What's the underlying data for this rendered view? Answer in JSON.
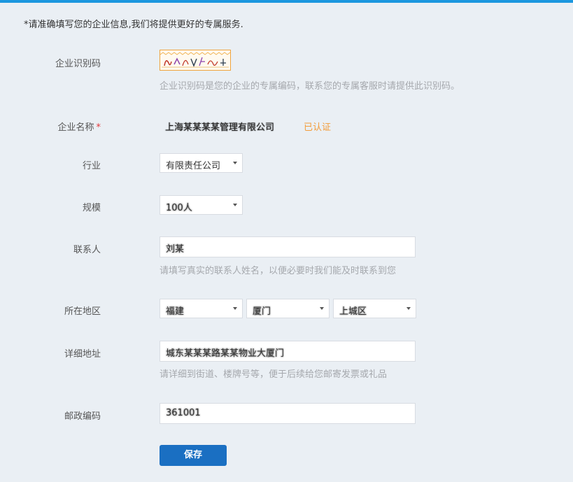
{
  "notice": "*请准确填写您的企业信息,我们将提供更好的专属服务.",
  "colors": {
    "accent": "#1c97df",
    "button": "#1a6fc2",
    "verified": "#f39c3a",
    "required": "#e4393c",
    "hint": "#a5a8ad"
  },
  "form": {
    "enterprise_code": {
      "label": "企业识别码",
      "hint": "企业识别码是您的企业的专属编码，联系您的专属客服时请提供此识别码。"
    },
    "company_name": {
      "label": "企业名称",
      "required_mark": "*",
      "value": "上海某某某某管理有限公司",
      "status": "已认证"
    },
    "industry": {
      "label": "行业",
      "selected": "有限责任公司"
    },
    "scale": {
      "label": "规模",
      "selected": "100人"
    },
    "contact": {
      "label": "联系人",
      "value": "刘某",
      "hint": "请填写真实的联系人姓名，以便必要时我们能及时联系到您"
    },
    "region": {
      "label": "所在地区",
      "province": "福建",
      "city": "厦门",
      "district": "上城区"
    },
    "address": {
      "label": "详细地址",
      "value": "城东某某某路某某物业大厦门",
      "hint": "请详细到街道、楼牌号等，便于后续给您邮寄发票或礼品"
    },
    "postal_code": {
      "label": "邮政编码",
      "value": "361001"
    }
  },
  "actions": {
    "save_label": "保存"
  }
}
